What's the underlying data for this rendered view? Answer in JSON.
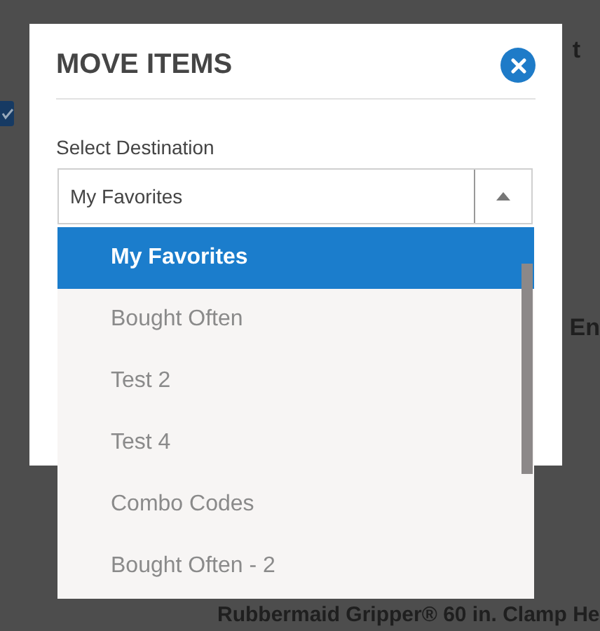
{
  "background": {
    "checkbox": {
      "checked": true
    },
    "texts": [
      {
        "kind": "top",
        "text": "t"
      },
      {
        "kind": "mid",
        "text": "En"
      },
      {
        "kind": "product",
        "text": "Rubbermaid Gripper® 60 in. Clamp He"
      }
    ]
  },
  "dialog": {
    "title": "MOVE ITEMS",
    "field_label": "Select Destination",
    "select": {
      "value": "My Favorites",
      "expanded": true
    },
    "options": [
      {
        "label": "My Favorites",
        "selected": true
      },
      {
        "label": "Bought Often",
        "selected": false
      },
      {
        "label": "Test 2",
        "selected": false
      },
      {
        "label": "Test 4",
        "selected": false
      },
      {
        "label": "Combo Codes",
        "selected": false
      },
      {
        "label": "Bought Often - 2",
        "selected": false
      }
    ]
  }
}
